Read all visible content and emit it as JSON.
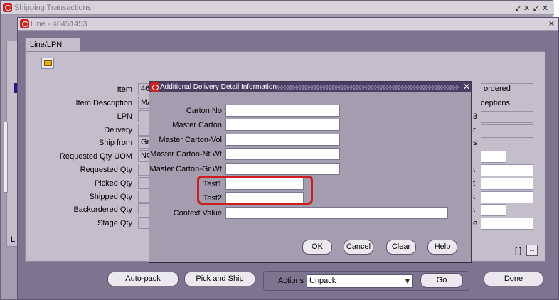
{
  "outer_window": {
    "title": "Shipping Transactions",
    "controls": [
      "↙",
      "✕",
      "↙",
      "✕"
    ]
  },
  "line_window": {
    "title": "Line - 40451453",
    "close": "✕",
    "tab_label": "Line/LPN",
    "toolbar_icon": "open-folder-icon",
    "labels": {
      "item": "Item",
      "item_description": "Item Description",
      "lpn": "LPN",
      "delivery": "Delivery",
      "ship_from": "Ship from",
      "requested_qty_uom": "Requested Qty UOM",
      "requested_qty": "Requested Qty",
      "picked_qty": "Picked Qty",
      "shipped_qty": "Shipped Qty",
      "backordered_qty": "Backordered Qty",
      "stage_qty": "Stage Qty"
    },
    "values": {
      "item": "46",
      "item_description": "MA",
      "ship_from": "Gr",
      "requested_qty_uom": "NC"
    },
    "right": {
      "status": "ordered",
      "exceptions_label": "ceptions",
      "label_fragments": [
        "3",
        "r",
        "s",
        "t",
        "t",
        "t",
        "t",
        "d",
        "e"
      ]
    },
    "bottom_left_glyph": "L",
    "indicator": "[ ]",
    "ellipsis": "..."
  },
  "dialog": {
    "title": "Additional Delivery Detail Information",
    "close": "✕",
    "fields": [
      {
        "label": "Carton No",
        "value": ""
      },
      {
        "label": "Master Carton",
        "value": ""
      },
      {
        "label": "Master Carton-Vol",
        "value": ""
      },
      {
        "label": "Master Carton-Nt.Wt",
        "value": ""
      },
      {
        "label": "Master Carton-Gr.Wt",
        "value": ""
      },
      {
        "label": "Test1",
        "value": ""
      },
      {
        "label": "Test2",
        "value": ""
      },
      {
        "label": "Context Value",
        "value": ""
      }
    ],
    "buttons": {
      "ok": "OK",
      "cancel": "Cancel",
      "clear": "Clear",
      "help": "Help"
    }
  },
  "footer": {
    "auto_pack": "Auto-pack",
    "pick_and_ship": "Pick and Ship",
    "actions_label": "Actions",
    "actions_value": "Unpack",
    "go": "Go",
    "done": "Done"
  },
  "colors": {
    "window_bg": "#7d7490",
    "panel_bg": "#c3bdcc",
    "dialog_title_bg": "#4a3f63",
    "highlight": "#cc1c1c"
  }
}
